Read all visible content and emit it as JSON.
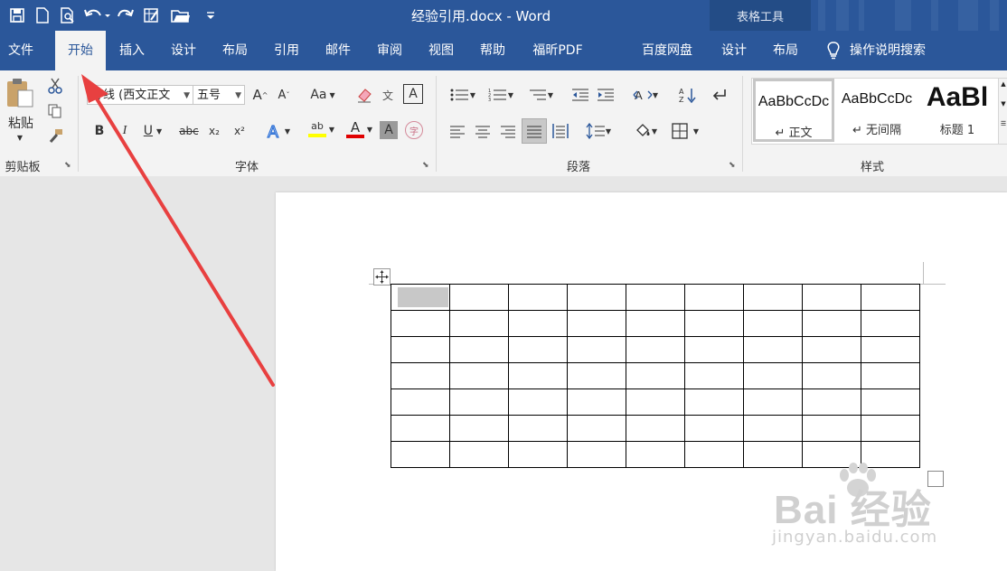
{
  "window": {
    "title": "经验引用.docx - Word",
    "context_tab_group": "表格工具"
  },
  "quick_access": {
    "icons": [
      "save-icon",
      "new-doc-icon",
      "print-preview-icon",
      "undo-icon",
      "redo-icon",
      "form-icon",
      "open-folder-icon",
      "customize-icon"
    ]
  },
  "tabs": [
    {
      "label": "文件",
      "active": false
    },
    {
      "label": "开始",
      "active": true
    },
    {
      "label": "插入",
      "active": false
    },
    {
      "label": "设计",
      "active": false
    },
    {
      "label": "布局",
      "active": false
    },
    {
      "label": "引用",
      "active": false
    },
    {
      "label": "邮件",
      "active": false
    },
    {
      "label": "审阅",
      "active": false
    },
    {
      "label": "视图",
      "active": false
    },
    {
      "label": "帮助",
      "active": false
    },
    {
      "label": "福昕PDF",
      "active": false
    },
    {
      "label": "百度网盘",
      "active": false
    },
    {
      "label": "设计",
      "active": false
    },
    {
      "label": "布局",
      "active": false
    }
  ],
  "tell_me": {
    "label": "操作说明搜索"
  },
  "ribbon": {
    "clipboard": {
      "group_label": "剪贴板",
      "paste_label": "粘贴"
    },
    "font": {
      "group_label": "字体",
      "font_name": "等线 (西文正文",
      "font_size": "五号",
      "grow_label": "A",
      "shrink_label": "A",
      "case_label": "Aa",
      "bold": "B",
      "italic": "I",
      "underline": "U",
      "strike": "abc",
      "subscript": "x₂",
      "superscript": "x²",
      "phonetic_label": "文",
      "enclose_label": "字",
      "font_color": "A",
      "highlight_label": "ab"
    },
    "paragraph": {
      "group_label": "段落"
    },
    "styles": {
      "group_label": "样式",
      "items": [
        {
          "sample": "AaBbCcDc",
          "name": "↵ 正文",
          "selected": true
        },
        {
          "sample": "AaBbCcDc",
          "name": "↵ 无间隔",
          "selected": false
        },
        {
          "sample": "AaBl",
          "name": "标题 1",
          "selected": false
        }
      ]
    }
  },
  "colors": {
    "title_bar": "#2b579a",
    "ribbon": "#f3f3f3",
    "font_color_swatch": "#e00000",
    "highlight_swatch": "#ffff00",
    "annotation_arrow": "#e84040"
  },
  "document": {
    "table": {
      "rows": 7,
      "columns": 9
    }
  },
  "watermark": {
    "main": "Bai 经验",
    "sub": "jingyan.baidu.com"
  }
}
